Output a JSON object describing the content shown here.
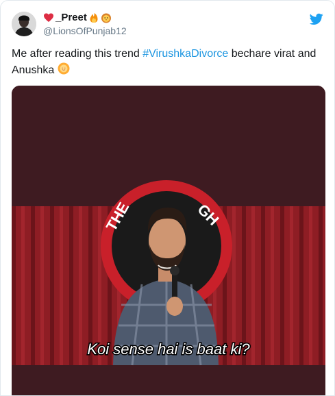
{
  "tweet": {
    "display_name": "_Preet",
    "handle": "@LionsOfPunjab12",
    "text_before": "Me after reading this trend ",
    "hashtag": "#VirushkaDivorce",
    "text_after": " bechare virat and Anushka"
  },
  "media": {
    "caption": "Koi sense hai is baat ki?",
    "logo_text_left": "THE",
    "logo_text_right": "GH"
  },
  "icons": {
    "heart": "red-heart-emoji",
    "fire": "fire-emoji",
    "lion": "lion-face-emoji",
    "sun": "sun-with-face-emoji",
    "brand": "twitter-bird-icon"
  },
  "colors": {
    "hashtag": "#1b95e0",
    "brand": "#1da1f2",
    "handle": "#657786",
    "curtain": "#8e1d24"
  }
}
